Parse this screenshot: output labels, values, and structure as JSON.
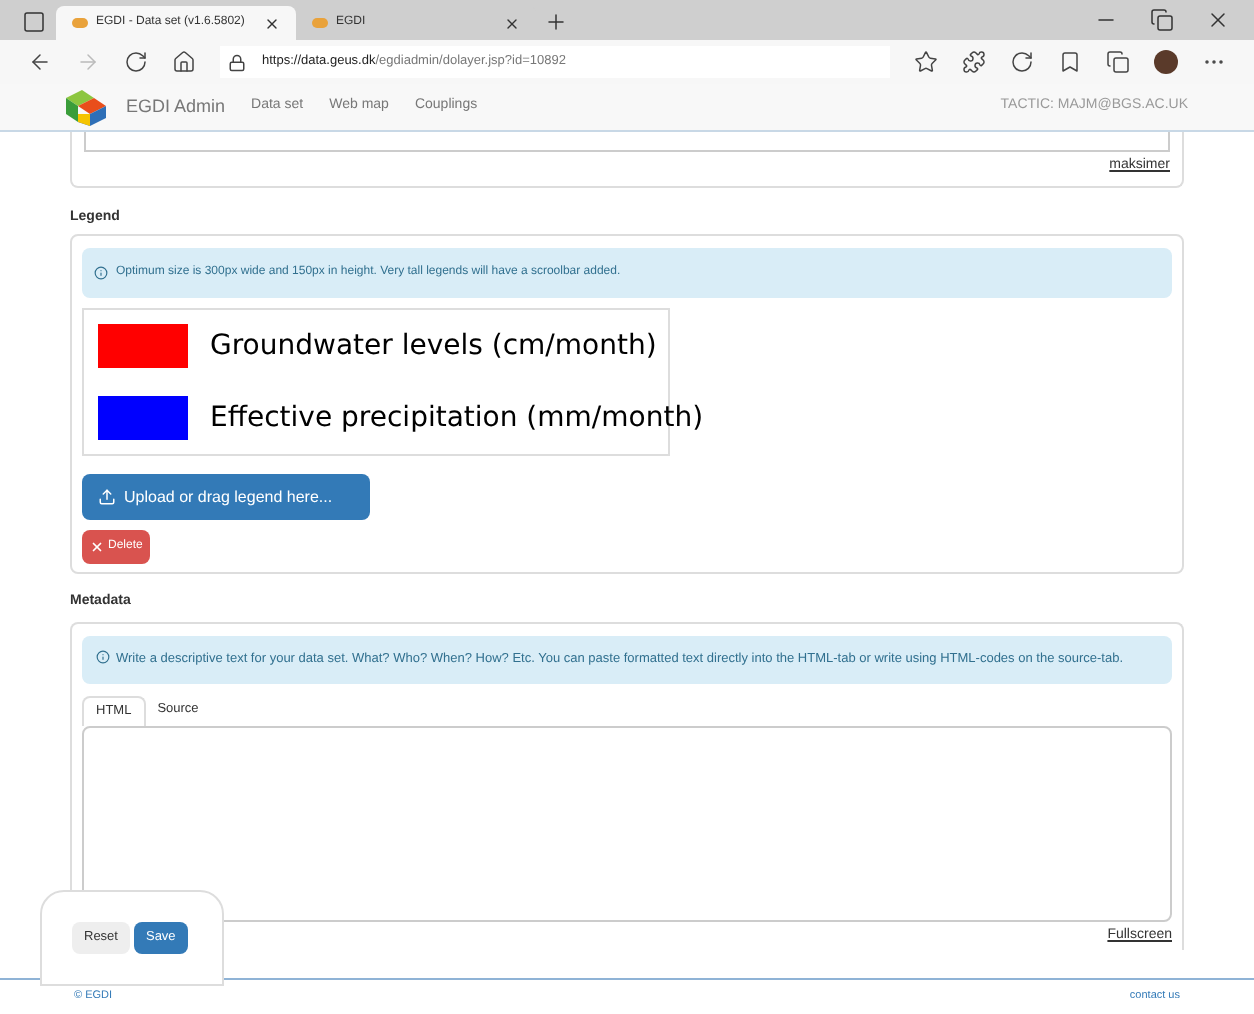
{
  "browser": {
    "tabs": [
      {
        "title": "EGDI - Data set (v1.6.5802)",
        "selected": true
      },
      {
        "title": "EGDI",
        "selected": false
      }
    ],
    "url_host": "https://data.geus.dk",
    "url_path": "/egdiadmin/dolayer.jsp?id=10892"
  },
  "navbar": {
    "brand": "EGDI Admin",
    "links": [
      "Data set",
      "Web map",
      "Couplings"
    ],
    "user": "TACTIC: MAJM@BGS.AC.UK"
  },
  "top_card": {
    "link": "maksimer"
  },
  "legend": {
    "heading": "Legend",
    "info": "Optimum size is 300px wide and 150px in height. Very tall legends will have a scroolbar added.",
    "entries": [
      {
        "label": "Groundwater levels (cm/month)",
        "color": "#ff0000"
      },
      {
        "label": "Effective precipitation (mm/month)",
        "color": "#0000ff"
      }
    ],
    "upload_button": "Upload or drag legend here...",
    "delete_button": "Delete"
  },
  "metadata": {
    "heading": "Metadata",
    "info": "Write a descriptive text for your data set. What? Who? When? How? Etc. You can paste formatted text directly into the HTML-tab or write using HTML-codes on the source-tab.",
    "tabs": [
      {
        "label": "HTML",
        "selected": true
      },
      {
        "label": "Source",
        "selected": false
      }
    ],
    "fullscreen_link": "Fullscreen"
  },
  "actions": {
    "reset": "Reset",
    "save": "Save"
  },
  "footer": {
    "copyright": "© EGDI",
    "contact": "contact us"
  }
}
